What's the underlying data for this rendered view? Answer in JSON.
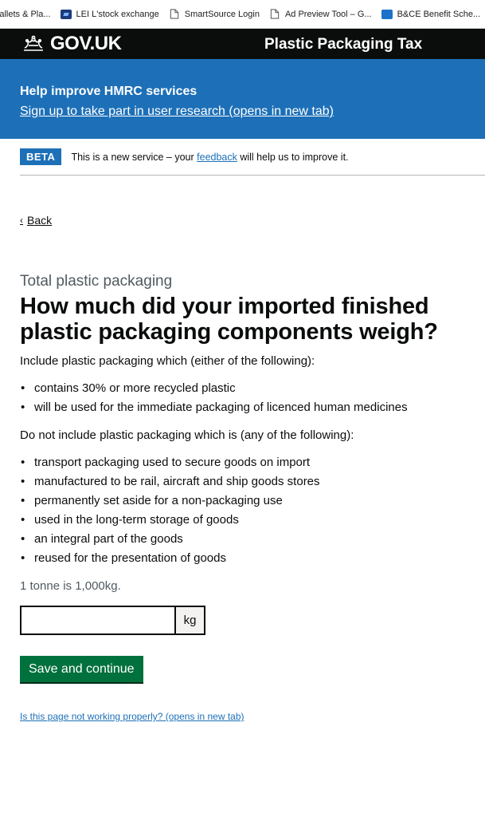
{
  "bookmarks": [
    {
      "label": "Pallets & Pla...",
      "icon": "folder-icon"
    },
    {
      "label": "LEI L'stock exchange",
      "icon": "lei-icon"
    },
    {
      "label": "SmartSource Login",
      "icon": "page-icon"
    },
    {
      "label": "Ad Preview Tool – G...",
      "icon": "page-icon"
    },
    {
      "label": "B&CE Benefit Sche...",
      "icon": "bce-icon"
    }
  ],
  "header": {
    "logo_text": "GOV.UK",
    "service_name": "Plastic Packaging Tax"
  },
  "banner": {
    "title": "Help improve HMRC services",
    "link": "Sign up to take part in user research (opens in new tab)"
  },
  "phase": {
    "tag": "BETA",
    "text_before": "This is a new service – your ",
    "link": "feedback",
    "text_after": " will help us to improve it."
  },
  "back": {
    "label": "Back"
  },
  "main": {
    "caption": "Total plastic packaging",
    "heading": "How much did your imported finished plastic packaging components weigh?",
    "include_intro": "Include plastic packaging which (either of the following):",
    "include_items": [
      "contains 30% or more recycled plastic",
      "will be used for the immediate packaging of licenced human medicines"
    ],
    "exclude_intro": "Do not include plastic packaging which is (any of the following):",
    "exclude_items": [
      "transport packaging used to secure goods on import",
      "manufactured to be rail, aircraft and ship goods stores",
      "permanently set aside for a non-packaging use",
      "used in the long-term storage of goods",
      "an integral part of the goods",
      "reused for the presentation of goods"
    ],
    "hint": "1 tonne is 1,000kg.",
    "input_value": "",
    "suffix": "kg",
    "button": "Save and continue",
    "help_link": "Is this page not working properly? (opens in new tab)"
  },
  "colors": {
    "brand_blue": "#1d70b8",
    "header_black": "#0b0c0c",
    "button_green": "#00703c"
  }
}
